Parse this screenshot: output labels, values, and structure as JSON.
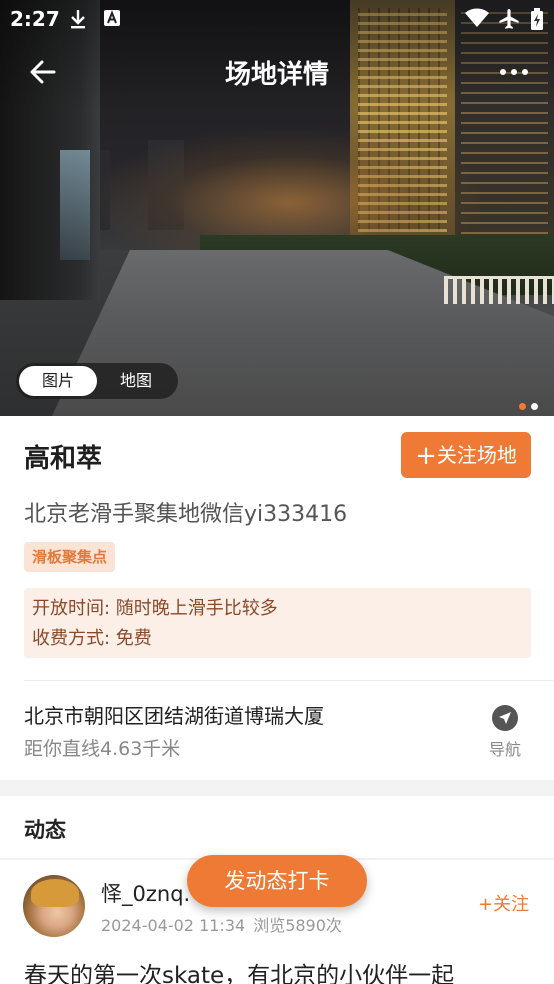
{
  "status_bar": {
    "time": "2:27",
    "left_icons": [
      "download-icon",
      "font-a-icon"
    ],
    "right_icons": [
      "wifi-icon",
      "airplane-icon",
      "battery-icon"
    ]
  },
  "app_bar": {
    "title": "场地详情",
    "back_icon": "back-arrow-icon",
    "more_icon": "more-icon"
  },
  "gallery": {
    "tabs": [
      {
        "label": "图片",
        "active": true
      },
      {
        "label": "地图",
        "active": false
      }
    ],
    "page_indicator": {
      "count": 2,
      "active_index": 0
    }
  },
  "venue": {
    "name": "高和萃",
    "follow_label": "关注场地",
    "follow_icon": "plus-icon",
    "description": "北京老滑手聚集地微信yi333416",
    "tag": "滑板聚集点",
    "hours": "开放时间: 随时晚上滑手比较多",
    "fee": "收费方式: 免费",
    "address": "北京市朝阳区团结湖街道博瑞大厦",
    "distance": "距你直线4.63千米",
    "nav_label": "导航",
    "nav_icon": "navigation-arrow-icon"
  },
  "feed": {
    "title": "动态",
    "checkin_label": "发动态打卡",
    "posts": [
      {
        "username": "怿_0znq.",
        "timestamp": "2024-04-02 11:34",
        "views": "浏览5890次",
        "follow_label": "+关注",
        "text": "春天的第一次skate，有北京的小伙伴一起"
      }
    ]
  },
  "colors": {
    "accent": "#ee7a35",
    "tag_bg": "#fbe4d6",
    "info_bg": "#fcefe8",
    "page_dot_active": "#ee7a35",
    "page_dot_inactive": "#ffffff"
  }
}
